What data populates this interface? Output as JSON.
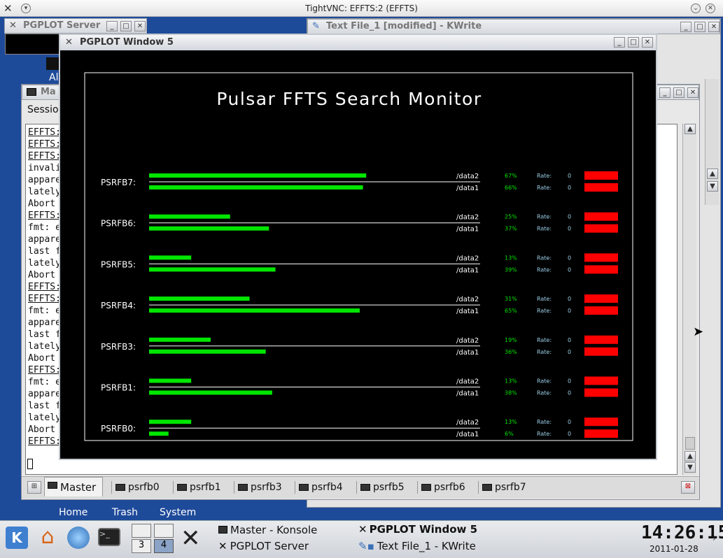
{
  "vnc": {
    "title": "TightVNC: EFFTS:2 (EFFTS)"
  },
  "bg_windows": {
    "pgplot_server_title": "PGPLOT Server",
    "kwrite_title": "Text File_1 [modified] - KWrite",
    "desktop_partial_label": "Al",
    "konsole_partial_title": "Ma"
  },
  "konsole": {
    "menu_partial": "Sessio",
    "lines": [
      {
        "text": "EFFTS:",
        "underline": true
      },
      {
        "text": "EFFTS:",
        "underline": true
      },
      {
        "text": "EFFTS:",
        "underline": true
      },
      {
        "text": "invali",
        "underline": false
      },
      {
        "text": "appare",
        "underline": false
      },
      {
        "text": "lately",
        "underline": false
      },
      {
        "text": "Abort",
        "underline": false
      },
      {
        "text": "EFFTS:",
        "underline": true
      },
      {
        "text": "fmt: e",
        "underline": false
      },
      {
        "text": "appare",
        "underline": false
      },
      {
        "text": "last f",
        "underline": false
      },
      {
        "text": "lately",
        "underline": false
      },
      {
        "text": "Abort",
        "underline": false
      },
      {
        "text": "EFFTS:",
        "underline": true
      },
      {
        "text": "EFFTS:",
        "underline": true
      },
      {
        "text": "fmt: e",
        "underline": false
      },
      {
        "text": "appare",
        "underline": false
      },
      {
        "text": "last f",
        "underline": false
      },
      {
        "text": "lately",
        "underline": false
      },
      {
        "text": "Abort",
        "underline": false
      },
      {
        "text": "EFFTS:",
        "underline": true
      },
      {
        "text": "fmt: e",
        "underline": false
      },
      {
        "text": "appare",
        "underline": false
      },
      {
        "text": "last f",
        "underline": false
      },
      {
        "text": "lately",
        "underline": false
      },
      {
        "text": "Abort",
        "underline": false
      },
      {
        "text": "EFFTS:",
        "underline": true
      }
    ],
    "tabs": [
      "Master",
      "psrfb0",
      "psrfb1",
      "psrfb3",
      "psrfb4",
      "psrfb5",
      "psrfb6",
      "psrfb7"
    ],
    "active_tab": "Master"
  },
  "pgplot": {
    "window_title": "PGPLOT Window 5",
    "monitor_title": "Pulsar FFTS Search Monitor",
    "rate_label": "Rate:",
    "colors": {
      "bar": "#00e600",
      "status": "#ff0000",
      "percent": "#00e600",
      "rate": "#9cd0e8"
    },
    "hosts": [
      {
        "name": "PSRFB7:",
        "disks": [
          {
            "path": "/data2",
            "pct": 67,
            "pct_label": "67%",
            "rate": "0"
          },
          {
            "path": "/data1",
            "pct": 66,
            "pct_label": "66%",
            "rate": "0"
          }
        ]
      },
      {
        "name": "PSRFB6:",
        "disks": [
          {
            "path": "/data2",
            "pct": 25,
            "pct_label": "25%",
            "rate": "0"
          },
          {
            "path": "/data1",
            "pct": 37,
            "pct_label": "37%",
            "rate": "0"
          }
        ]
      },
      {
        "name": "PSRFB5:",
        "disks": [
          {
            "path": "/data2",
            "pct": 13,
            "pct_label": "13%",
            "rate": "0"
          },
          {
            "path": "/data1",
            "pct": 39,
            "pct_label": "39%",
            "rate": "0"
          }
        ]
      },
      {
        "name": "PSRFB4:",
        "disks": [
          {
            "path": "/data2",
            "pct": 31,
            "pct_label": "31%",
            "rate": "0"
          },
          {
            "path": "/data1",
            "pct": 65,
            "pct_label": "65%",
            "rate": "0"
          }
        ]
      },
      {
        "name": "PSRFB3:",
        "disks": [
          {
            "path": "/data2",
            "pct": 19,
            "pct_label": "19%",
            "rate": "0"
          },
          {
            "path": "/data1",
            "pct": 36,
            "pct_label": "36%",
            "rate": "0"
          }
        ]
      },
      {
        "name": "PSRFB1:",
        "disks": [
          {
            "path": "/data2",
            "pct": 13,
            "pct_label": "13%",
            "rate": "0"
          },
          {
            "path": "/data1",
            "pct": 38,
            "pct_label": "38%",
            "rate": "0"
          }
        ]
      },
      {
        "name": "PSRFB0:",
        "disks": [
          {
            "path": "/data2",
            "pct": 13,
            "pct_label": "13%",
            "rate": "0"
          },
          {
            "path": "/data1",
            "pct": 6,
            "pct_label": "6%",
            "rate": "0"
          }
        ]
      }
    ]
  },
  "desktop_icons": [
    {
      "label": "Home",
      "icon": "home-icon"
    },
    {
      "label": "Trash",
      "icon": "trash-icon"
    },
    {
      "label": "System",
      "icon": "system-icon"
    }
  ],
  "taskbar": {
    "pager": [
      "3",
      "4"
    ],
    "tasks": [
      {
        "label": "Master - Konsole",
        "icon": "konsole-icon"
      },
      {
        "label": "PGPLOT Window 5",
        "icon": "x-icon",
        "active": true
      },
      {
        "label": "PGPLOT Server",
        "icon": "x-icon"
      },
      {
        "label": "Text File_1 - KWrite",
        "icon": "kwrite-icon"
      }
    ],
    "clock_time": "14:26:15",
    "clock_date": "2011-01-28"
  }
}
